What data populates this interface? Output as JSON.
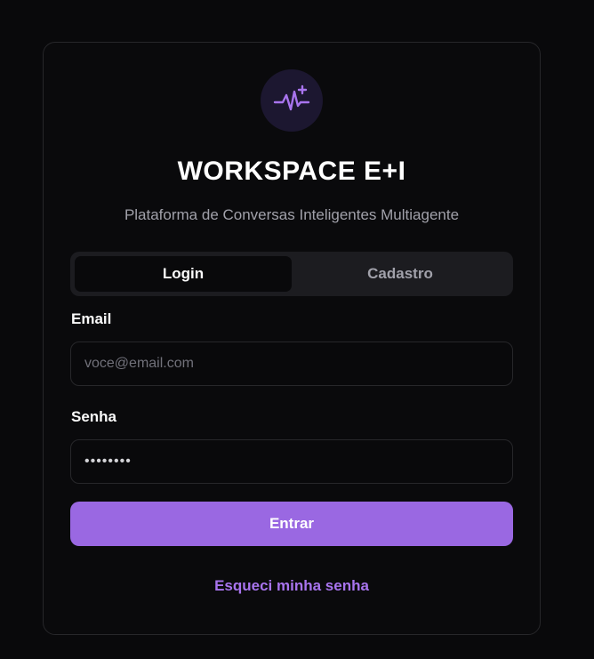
{
  "brand": {
    "title": "WORKSPACE E+I",
    "subtitle": "Plataforma de Conversas Inteligentes Multiagente",
    "logo_icon": "sparkle-wave-icon",
    "accent": "#9a68e2"
  },
  "tabs": [
    {
      "label": "Login",
      "active": true
    },
    {
      "label": "Cadastro",
      "active": false
    }
  ],
  "form": {
    "email_label": "Email",
    "email_placeholder": "voce@email.com",
    "password_label": "Senha",
    "password_value": "••••••••",
    "submit_label": "Entrar",
    "forgot_label": "Esqueci minha senha"
  }
}
